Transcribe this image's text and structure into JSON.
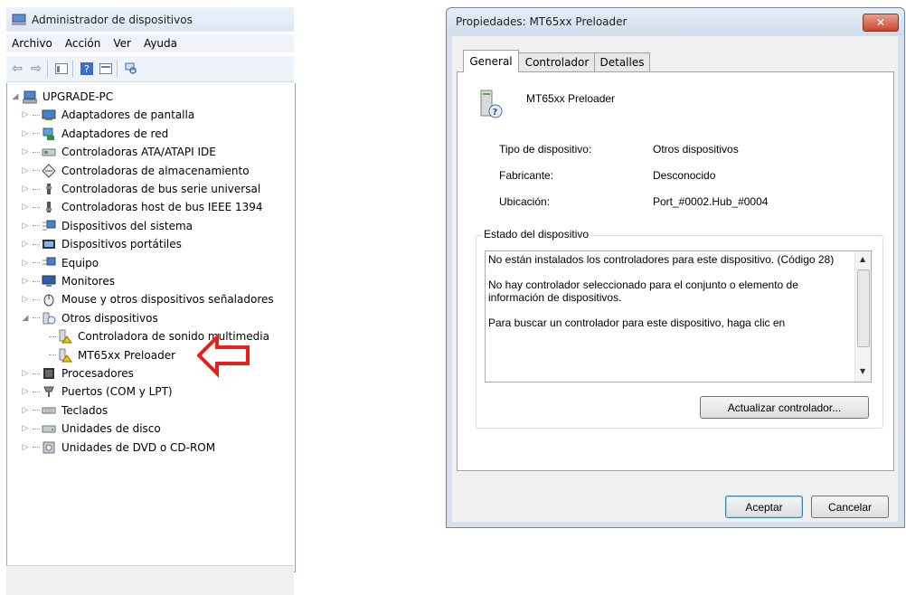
{
  "device_manager": {
    "title": "Administrador de dispositivos",
    "menu": [
      "Archivo",
      "Acción",
      "Ver",
      "Ayuda"
    ],
    "toolbar_icons": [
      "back-icon",
      "forward-icon",
      "console-tree-icon",
      "help-icon",
      "details-view-icon",
      "scan-hardware-icon"
    ],
    "root": "UPGRADE-PC",
    "categories": [
      {
        "label": "Adaptadores de pantalla",
        "icon": "display-adapter-icon"
      },
      {
        "label": "Adaptadores de red",
        "icon": "network-adapter-icon"
      },
      {
        "label": "Controladoras ATA/ATAPI IDE",
        "icon": "ide-controller-icon"
      },
      {
        "label": "Controladoras de almacenamiento",
        "icon": "storage-controller-icon"
      },
      {
        "label": "Controladoras de bus serie universal",
        "icon": "usb-icon"
      },
      {
        "label": "Controladoras host de bus IEEE 1394",
        "icon": "ieee1394-icon"
      },
      {
        "label": "Dispositivos del sistema",
        "icon": "system-device-icon"
      },
      {
        "label": "Dispositivos portátiles",
        "icon": "portable-device-icon"
      },
      {
        "label": "Equipo",
        "icon": "computer-icon"
      },
      {
        "label": "Monitores",
        "icon": "monitor-icon"
      },
      {
        "label": "Mouse y otros dispositivos señaladores",
        "icon": "mouse-icon"
      },
      {
        "label": "Otros dispositivos",
        "icon": "unknown-device-icon"
      },
      {
        "label": "Procesadores",
        "icon": "processor-icon"
      },
      {
        "label": "Puertos (COM y LPT)",
        "icon": "port-icon"
      },
      {
        "label": "Teclados",
        "icon": "keyboard-icon"
      },
      {
        "label": "Unidades de disco",
        "icon": "disk-drive-icon"
      },
      {
        "label": "Unidades de DVD o CD-ROM",
        "icon": "dvd-drive-icon"
      }
    ],
    "other_devices_children": [
      {
        "label": "Controladora de sonido multimedia",
        "icon": "unknown-device-warning-icon"
      },
      {
        "label": "MT65xx Preloader",
        "icon": "unknown-device-warning-icon"
      }
    ]
  },
  "properties": {
    "title": "Propiedades: MT65xx Preloader",
    "tabs": [
      "General",
      "Controlador",
      "Detalles"
    ],
    "active_tab": "General",
    "device_name": "MT65xx Preloader",
    "fields": [
      {
        "label": "Tipo de dispositivo:",
        "value": "Otros dispositivos"
      },
      {
        "label": "Fabricante:",
        "value": "Desconocido"
      },
      {
        "label": "Ubicación:",
        "value": "Port_#0002.Hub_#0004"
      }
    ],
    "status_group_label": "Estado del dispositivo",
    "status_text": [
      "No están instalados los controladores para este dispositivo. (Código 28)",
      "No hay controlador seleccionado para el conjunto o elemento de información de dispositivos.",
      "Para buscar un controlador para este dispositivo, haga clic en"
    ],
    "update_button": "Actualizar controlador...",
    "ok_button": "Aceptar",
    "cancel_button": "Cancelar"
  },
  "colors": {
    "annotation_arrow": "#e8201c"
  }
}
